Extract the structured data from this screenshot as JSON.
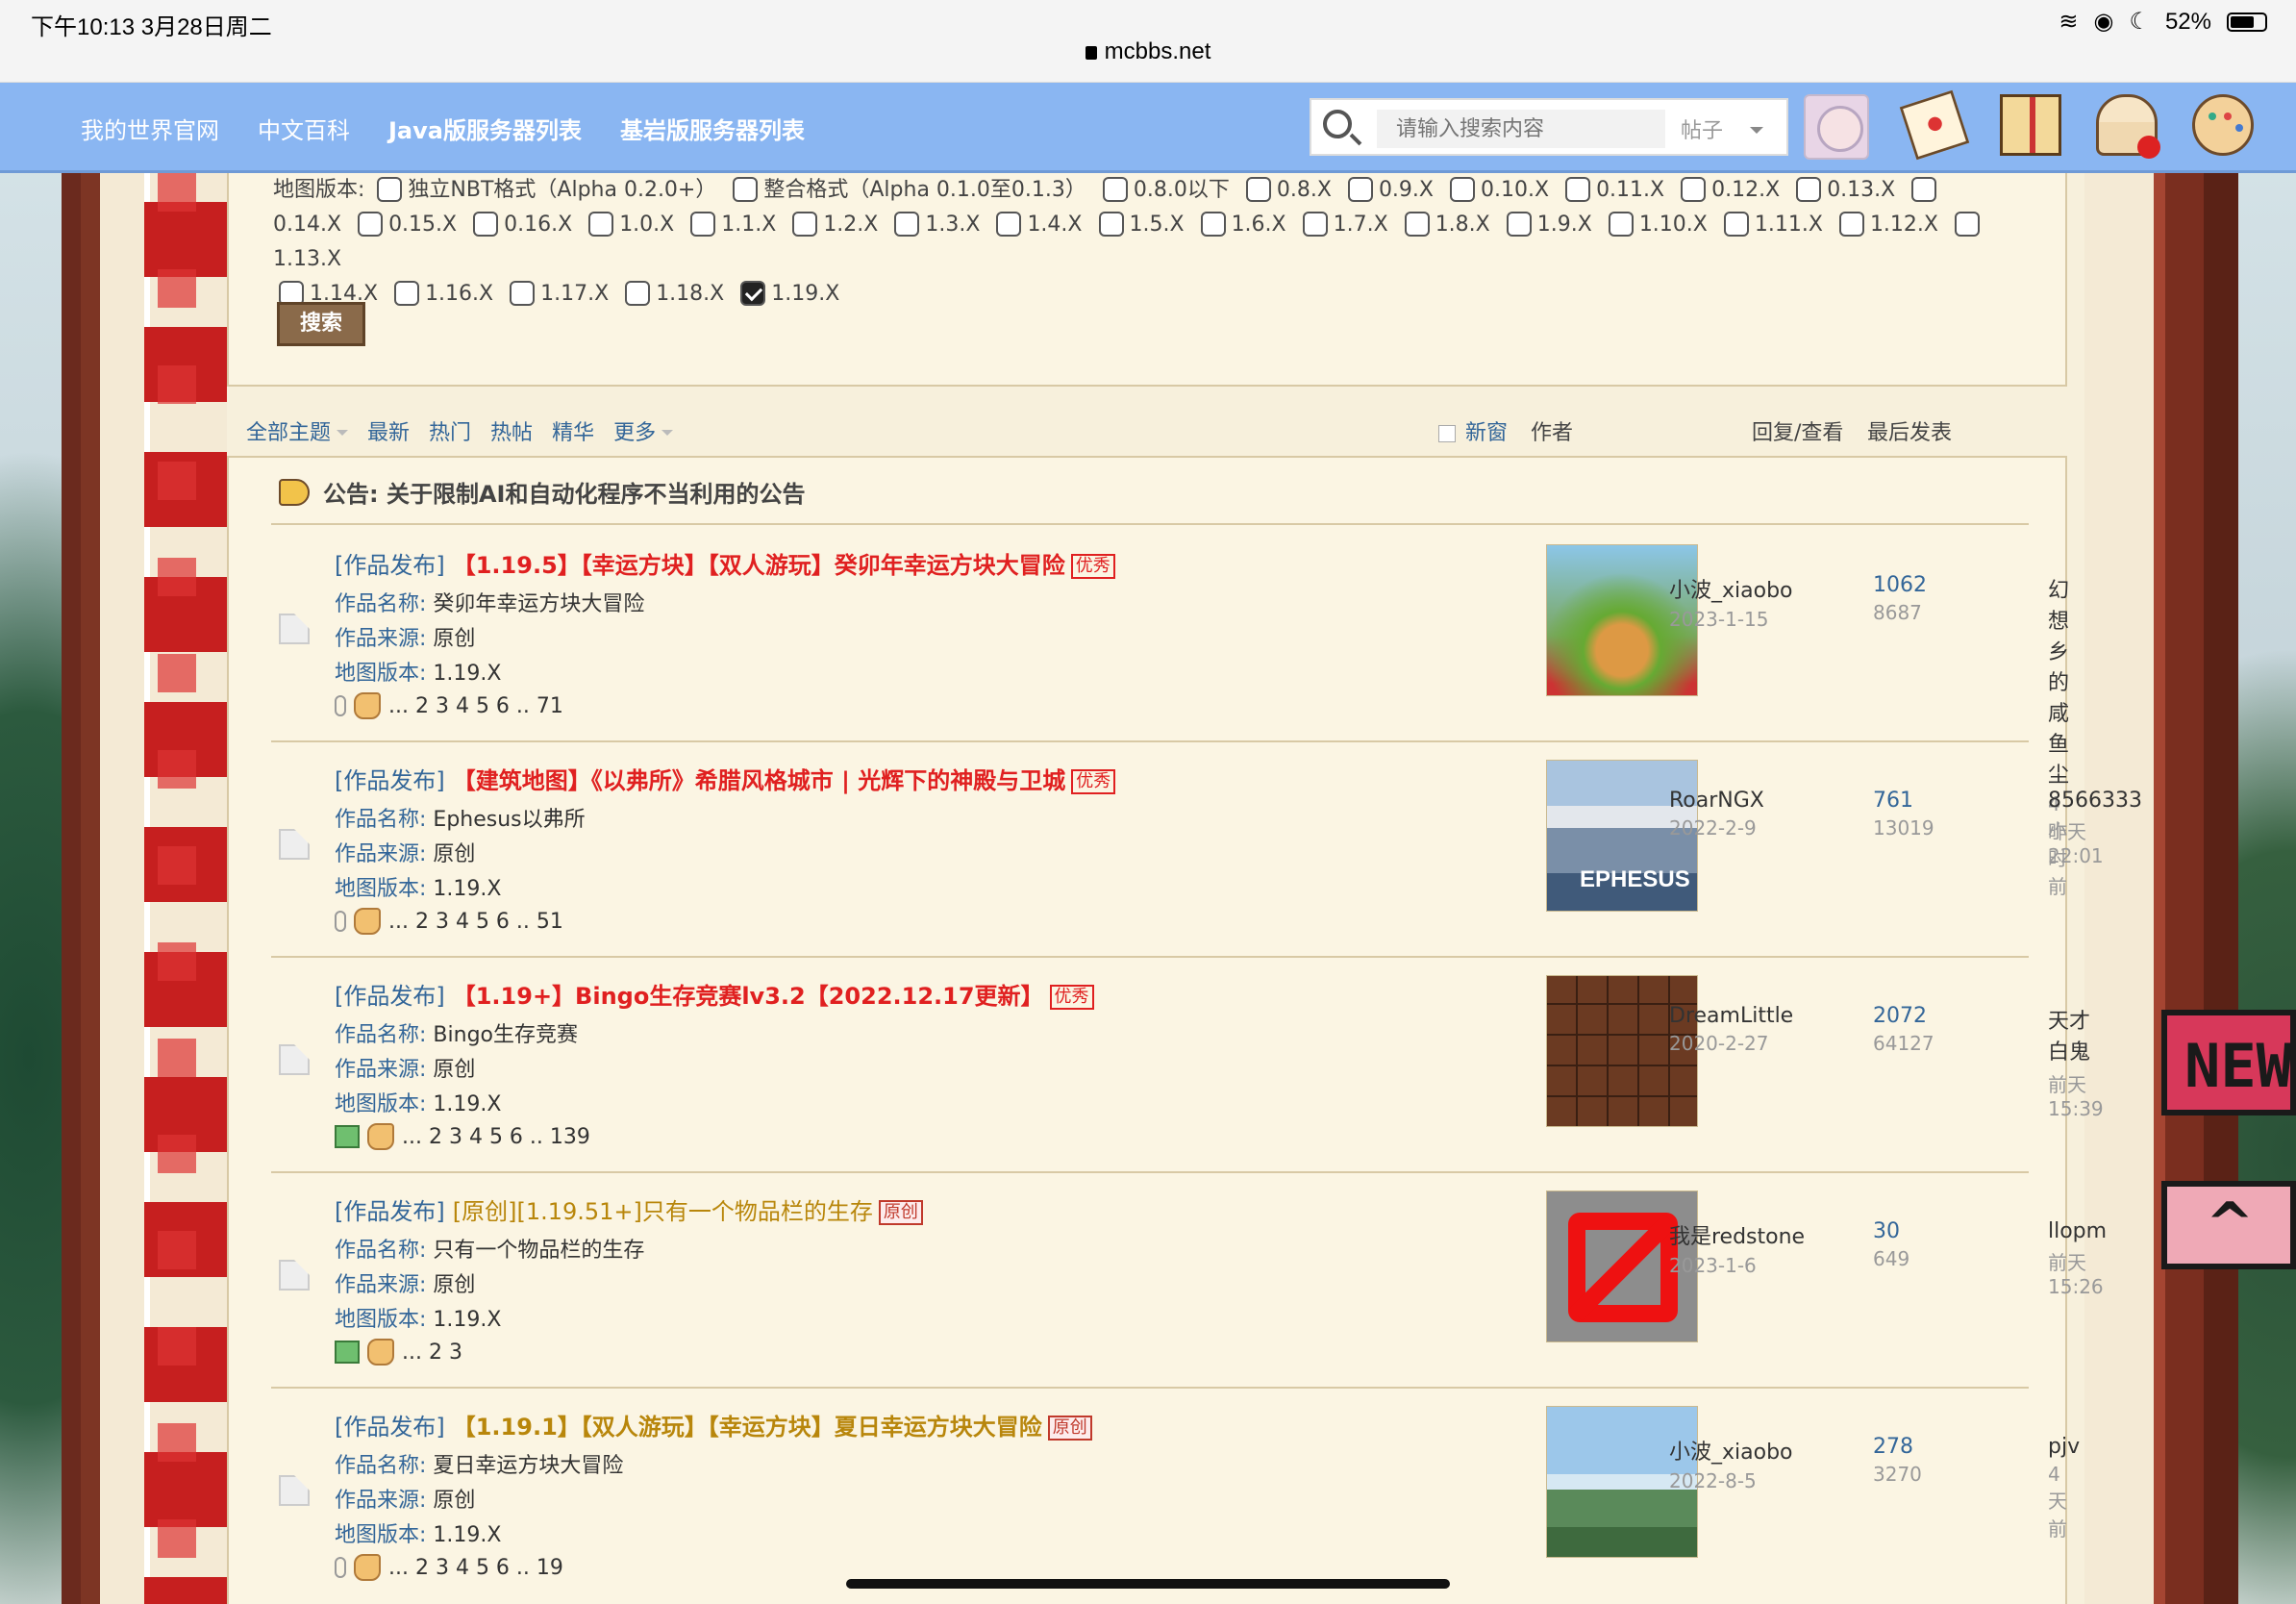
{
  "status": {
    "time": "下午10:13  3月28日周二",
    "battery": "52%",
    "url": "mcbbs.net"
  },
  "nav": {
    "links": [
      "我的世界官网",
      "中文百科",
      "Java版服务器列表",
      "基岩版服务器列表"
    ],
    "search_placeholder": "请输入搜索内容",
    "search_type": "帖子"
  },
  "filter": {
    "label": "地图版本:",
    "row1": [
      "独立NBT格式（Alpha 0.2.0+）",
      "整合格式（Alpha 0.1.0至0.1.3）",
      "0.8.0以下",
      "0.8.X",
      "0.9.X",
      "0.10.X",
      "0.11.X",
      "0.12.X",
      "0.13.X"
    ],
    "row2": [
      "0.14.X",
      "0.15.X",
      "0.16.X",
      "1.0.X",
      "1.1.X",
      "1.2.X",
      "1.3.X",
      "1.4.X",
      "1.5.X",
      "1.6.X",
      "1.7.X",
      "1.8.X",
      "1.9.X",
      "1.10.X",
      "1.11.X",
      "1.12.X",
      "1.13.X"
    ],
    "row3": [
      "1.14.X",
      "1.16.X",
      "1.17.X",
      "1.18.X",
      "1.19.X"
    ],
    "checked": "1.19.X",
    "search_btn": "搜索"
  },
  "tabs": {
    "all": "全部主题",
    "latest": "最新",
    "hot": "热门",
    "hotpost": "热帖",
    "digest": "精华",
    "more": "更多",
    "new_window": "新窗",
    "author": "作者",
    "replies": "回复/查看",
    "last_post": "最后发表"
  },
  "announcement": {
    "prefix": "公告:",
    "text": "关于限制AI和自动化程序不当利用的公告"
  },
  "meta_labels": {
    "name": "作品名称:",
    "source": "作品来源:",
    "version": "地图版本:"
  },
  "threads": [
    {
      "category": "[作品发布]",
      "title": "【1.19.5】【幸运方块】【双人游玩】癸卯年幸运方块大冒险",
      "badge": "优秀",
      "name": "癸卯年幸运方块大冒险",
      "source": "原创",
      "version": "1.19.X",
      "pages": "... 2  3  4  5  6 .. 71",
      "author": "小波_xiaobo",
      "date": "2023-1-15",
      "replies": "1062",
      "views": "8687",
      "last_user": "幻想乡的咸鱼尘",
      "last_time": "4 小时前"
    },
    {
      "category": "[作品发布]",
      "title": "【建筑地图】《以弗所》希腊风格城市 | 光辉下的神殿与卫城",
      "badge": "优秀",
      "name": "Ephesus以弗所",
      "source": "原创",
      "version": "1.19.X",
      "pages": "... 2  3  4  5  6 .. 51",
      "author": "RoarNGX",
      "date": "2022-2-9",
      "replies": "761",
      "views": "13019",
      "last_user": "8566333",
      "last_time": "昨天 22:01",
      "thumb_text": "EPHESUS"
    },
    {
      "category": "[作品发布]",
      "title": "【1.19+】Bingo生存竞赛lv3.2【2022.12.17更新】",
      "badge": "优秀",
      "name": "Bingo生存竞赛",
      "source": "原创",
      "version": "1.19.X",
      "pages": "... 2  3  4  5  6 .. 139",
      "author": "DreamLittle",
      "date": "2020-2-27",
      "replies": "2072",
      "views": "64127",
      "last_user": "天才白鬼",
      "last_time": "前天 15:39"
    },
    {
      "category": "[作品发布]",
      "title": "[原创][1.19.51+]只有一个物品栏的生存",
      "badge": "原创",
      "name": "只有一个物品栏的生存",
      "source": "原创",
      "version": "1.19.X",
      "pages": "... 2  3",
      "author": "我是redstone",
      "date": "2023-1-6",
      "replies": "30",
      "views": "649",
      "last_user": "llopm",
      "last_time": "前天 15:26"
    },
    {
      "category": "[作品发布]",
      "title": "【1.19.1】【双人游玩】【幸运方块】夏日幸运方块大冒险",
      "badge": "原创",
      "name": "夏日幸运方块大冒险",
      "source": "原创",
      "version": "1.19.X",
      "pages": "... 2  3  4  5  6 .. 19",
      "author": "小波_xiaobo",
      "date": "2022-8-5",
      "replies": "278",
      "views": "3270",
      "last_user": "pjv",
      "last_time": "4 天前"
    }
  ],
  "side_signs": {
    "new": "NEW",
    "up": "^"
  }
}
